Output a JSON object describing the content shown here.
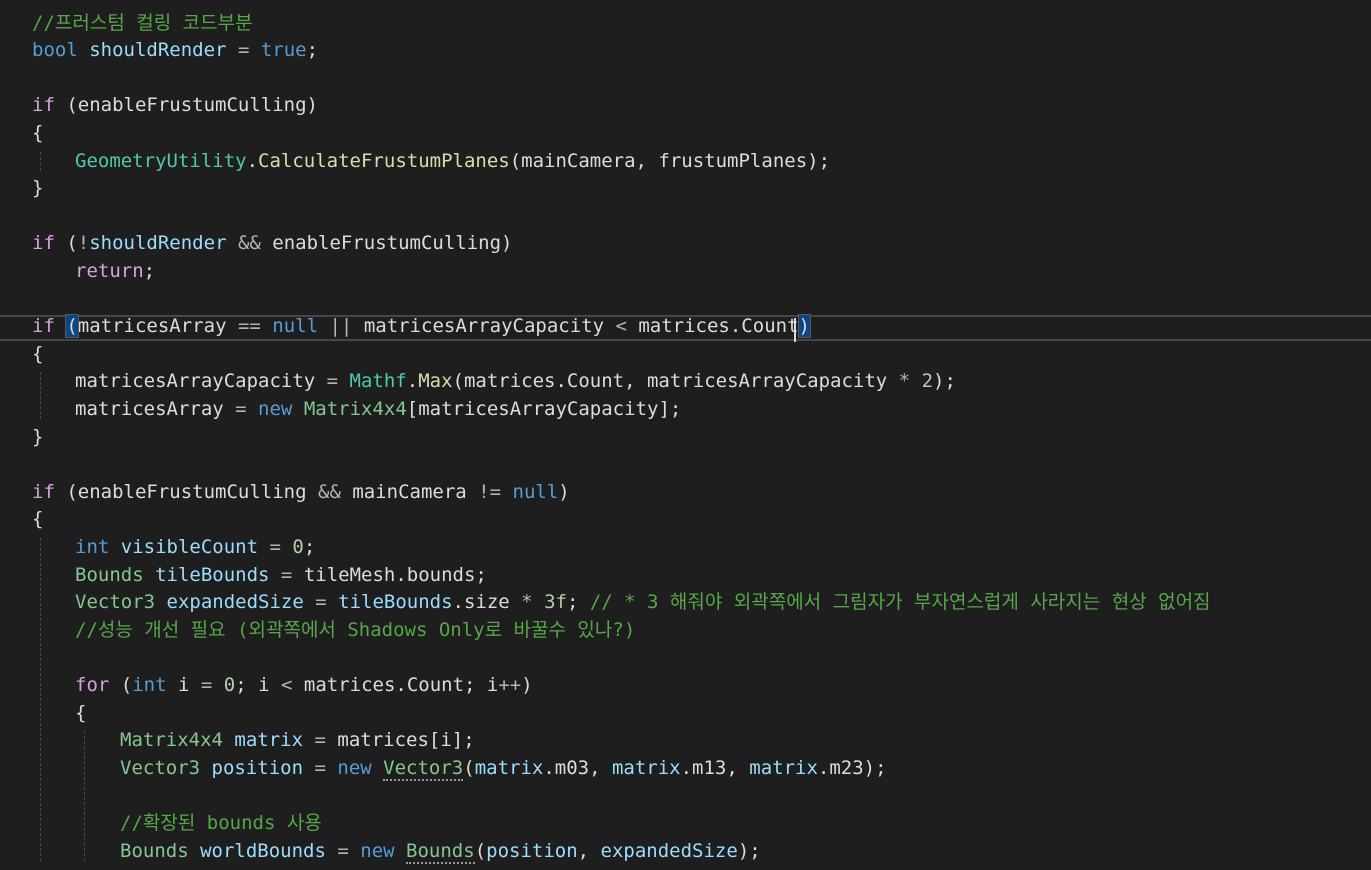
{
  "editor": {
    "lines": [
      {
        "indent": 0,
        "tokens": [
          {
            "t": "//프러스텀 컬링 코드부분",
            "c": "cmt"
          }
        ]
      },
      {
        "indent": 0,
        "tokens": [
          {
            "t": "bool",
            "c": "kw"
          },
          {
            "t": " "
          },
          {
            "t": "shouldRender",
            "c": "var"
          },
          {
            "t": " = ",
            "c": "op"
          },
          {
            "t": "true",
            "c": "kw"
          },
          {
            "t": ";"
          }
        ]
      },
      {
        "indent": 0,
        "tokens": []
      },
      {
        "indent": 0,
        "tokens": [
          {
            "t": "if",
            "c": "ctl"
          },
          {
            "t": " (enableFrustumCulling)"
          }
        ]
      },
      {
        "indent": 0,
        "tokens": [
          {
            "t": "{"
          }
        ]
      },
      {
        "indent": 1,
        "tokens": [
          {
            "t": "GeometryUtility",
            "c": "type"
          },
          {
            "t": "."
          },
          {
            "t": "CalculateFrustumPlanes",
            "c": "method"
          },
          {
            "t": "(mainCamera, frustumPlanes);"
          }
        ]
      },
      {
        "indent": 0,
        "tokens": [
          {
            "t": "}"
          }
        ]
      },
      {
        "indent": 0,
        "tokens": []
      },
      {
        "indent": 0,
        "tokens": [
          {
            "t": "if",
            "c": "ctl"
          },
          {
            "t": " ("
          },
          {
            "t": "!",
            "c": "op"
          },
          {
            "t": "shouldRender",
            "c": "var"
          },
          {
            "t": " && ",
            "c": "op"
          },
          {
            "t": "enableFrustumCulling)"
          }
        ]
      },
      {
        "indent": 1,
        "tokens": [
          {
            "t": "return",
            "c": "ctl"
          },
          {
            "t": ";"
          }
        ]
      },
      {
        "indent": 0,
        "tokens": []
      },
      {
        "indent": 0,
        "tokens": [
          {
            "t": "if",
            "c": "ctl"
          },
          {
            "t": " "
          },
          {
            "t": "(",
            "c": "match"
          },
          {
            "t": "matricesArray"
          },
          {
            "t": " == ",
            "c": "op"
          },
          {
            "t": "null",
            "c": "kw"
          },
          {
            "t": " || ",
            "c": "op"
          },
          {
            "t": "matricesArrayCapacity"
          },
          {
            "t": " < ",
            "c": "op"
          },
          {
            "t": "matrices.Count"
          },
          {
            "t": ")",
            "c": "match"
          }
        ]
      },
      {
        "indent": 0,
        "tokens": [
          {
            "t": "{"
          }
        ]
      },
      {
        "indent": 1,
        "tokens": [
          {
            "t": "matricesArrayCapacity"
          },
          {
            "t": " = ",
            "c": "op"
          },
          {
            "t": "Mathf",
            "c": "type"
          },
          {
            "t": "."
          },
          {
            "t": "Max",
            "c": "method"
          },
          {
            "t": "(matrices.Count, matricesArrayCapacity "
          },
          {
            "t": "*",
            "c": "op"
          },
          {
            "t": " "
          },
          {
            "t": "2",
            "c": "num"
          },
          {
            "t": ");"
          }
        ]
      },
      {
        "indent": 1,
        "tokens": [
          {
            "t": "matricesArray"
          },
          {
            "t": " = ",
            "c": "op"
          },
          {
            "t": "new",
            "c": "kw"
          },
          {
            "t": " "
          },
          {
            "t": "Matrix4x4",
            "c": "type2"
          },
          {
            "t": "[matricesArrayCapacity];"
          }
        ]
      },
      {
        "indent": 0,
        "tokens": [
          {
            "t": "}"
          }
        ]
      },
      {
        "indent": 0,
        "tokens": []
      },
      {
        "indent": 0,
        "tokens": [
          {
            "t": "if",
            "c": "ctl"
          },
          {
            "t": " (enableFrustumCulling "
          },
          {
            "t": "&&",
            "c": "op"
          },
          {
            "t": " mainCamera "
          },
          {
            "t": "!=",
            "c": "op"
          },
          {
            "t": " "
          },
          {
            "t": "null",
            "c": "kw"
          },
          {
            "t": ")"
          }
        ]
      },
      {
        "indent": 0,
        "tokens": [
          {
            "t": "{"
          }
        ]
      },
      {
        "indent": 1,
        "tokens": [
          {
            "t": "int",
            "c": "kw"
          },
          {
            "t": " "
          },
          {
            "t": "visibleCount",
            "c": "var"
          },
          {
            "t": " = ",
            "c": "op"
          },
          {
            "t": "0",
            "c": "num"
          },
          {
            "t": ";"
          }
        ]
      },
      {
        "indent": 1,
        "tokens": [
          {
            "t": "Bounds",
            "c": "type2"
          },
          {
            "t": " "
          },
          {
            "t": "tileBounds",
            "c": "var"
          },
          {
            "t": " = ",
            "c": "op"
          },
          {
            "t": "tileMesh.bounds;"
          }
        ]
      },
      {
        "indent": 1,
        "tokens": [
          {
            "t": "Vector3",
            "c": "type2"
          },
          {
            "t": " "
          },
          {
            "t": "expandedSize",
            "c": "var"
          },
          {
            "t": " = ",
            "c": "op"
          },
          {
            "t": "tileBounds",
            "c": "var"
          },
          {
            "t": ".size "
          },
          {
            "t": "*",
            "c": "op"
          },
          {
            "t": " "
          },
          {
            "t": "3f",
            "c": "num"
          },
          {
            "t": "; "
          },
          {
            "t": "// * 3 해줘야 외곽쪽에서 그림자가 부자연스럽게 사라지는 현상 없어짐",
            "c": "cmt"
          }
        ]
      },
      {
        "indent": 1,
        "tokens": [
          {
            "t": "//성능 개선 필요 (외곽쪽에서 Shadows Only로 바꿀수 있나?)",
            "c": "cmt"
          }
        ]
      },
      {
        "indent": 1,
        "tokens": []
      },
      {
        "indent": 1,
        "tokens": [
          {
            "t": "for",
            "c": "ctl"
          },
          {
            "t": " ("
          },
          {
            "t": "int",
            "c": "kw"
          },
          {
            "t": " i "
          },
          {
            "t": "=",
            "c": "op"
          },
          {
            "t": " "
          },
          {
            "t": "0",
            "c": "num"
          },
          {
            "t": "; i "
          },
          {
            "t": "<",
            "c": "op"
          },
          {
            "t": " matrices.Count; i"
          },
          {
            "t": "++",
            "c": "op"
          },
          {
            "t": ")"
          }
        ]
      },
      {
        "indent": 1,
        "tokens": [
          {
            "t": "{"
          }
        ]
      },
      {
        "indent": 2,
        "tokens": [
          {
            "t": "Matrix4x4",
            "c": "type2"
          },
          {
            "t": " "
          },
          {
            "t": "matrix",
            "c": "var"
          },
          {
            "t": " = ",
            "c": "op"
          },
          {
            "t": "matrices[i];"
          }
        ]
      },
      {
        "indent": 2,
        "tokens": [
          {
            "t": "Vector3",
            "c": "type2"
          },
          {
            "t": " "
          },
          {
            "t": "position",
            "c": "var"
          },
          {
            "t": " = ",
            "c": "op"
          },
          {
            "t": "new",
            "c": "kw"
          },
          {
            "t": " "
          },
          {
            "t": "Vector3",
            "c": "type2-squiggle"
          },
          {
            "t": "("
          },
          {
            "t": "matrix",
            "c": "var"
          },
          {
            "t": ".m03, "
          },
          {
            "t": "matrix",
            "c": "var"
          },
          {
            "t": ".m13, "
          },
          {
            "t": "matrix",
            "c": "var"
          },
          {
            "t": ".m23);"
          }
        ]
      },
      {
        "indent": 2,
        "tokens": []
      },
      {
        "indent": 2,
        "tokens": [
          {
            "t": "//확장된 bounds 사용",
            "c": "cmt"
          }
        ]
      },
      {
        "indent": 2,
        "tokens": [
          {
            "t": "Bounds",
            "c": "type2"
          },
          {
            "t": " "
          },
          {
            "t": "worldBounds",
            "c": "var"
          },
          {
            "t": " = ",
            "c": "op"
          },
          {
            "t": "new",
            "c": "kw"
          },
          {
            "t": " "
          },
          {
            "t": "Bounds",
            "c": "type2-squiggle"
          },
          {
            "t": "("
          },
          {
            "t": "position",
            "c": "var"
          },
          {
            "t": ", "
          },
          {
            "t": "expandedSize",
            "c": "var"
          },
          {
            "t": ");"
          }
        ]
      }
    ]
  }
}
